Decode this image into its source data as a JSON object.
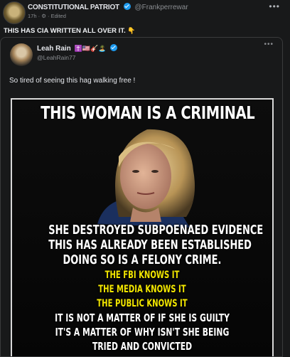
{
  "post": {
    "author_name": "CONSTITUTIONAL PATRIOT",
    "handle": "@Frankperrewar",
    "time": "17h",
    "edited": "Edited",
    "more": "•••",
    "text": "THIS HAS CIA WRITTEN ALL OVER IT.",
    "text_emoji": "👇"
  },
  "shared": {
    "author_name": "Leah Rain",
    "author_emojis": "✝️🇺🇸🎸🏝️",
    "handle": "@LeahRain77",
    "more": "•••",
    "text": "So tired of seeing this hag walking free !"
  },
  "meme": {
    "lines": [
      "THIS WOMAN IS A CRIMINAL",
      "SHE DESTROYED SUBPOENAED EVIDENCE",
      "THIS HAS ALREADY BEEN ESTABLISHED",
      "DOING SO IS A FELONY CRIME.",
      "THE FBI KNOWS IT",
      "THE MEDIA KNOWS IT",
      "THE PUBLIC KNOWS IT",
      "IT IS NOT A MATTER OF IF SHE IS GUILTY",
      "IT'S A MATTER OF WHY ISN'T SHE BEING",
      "TRIED AND CONVICTED"
    ]
  },
  "colors": {
    "background": "#18191a",
    "meme_text": "#ffffff",
    "meme_highlight": "#f2e600",
    "verified": "#1d9bf0"
  }
}
